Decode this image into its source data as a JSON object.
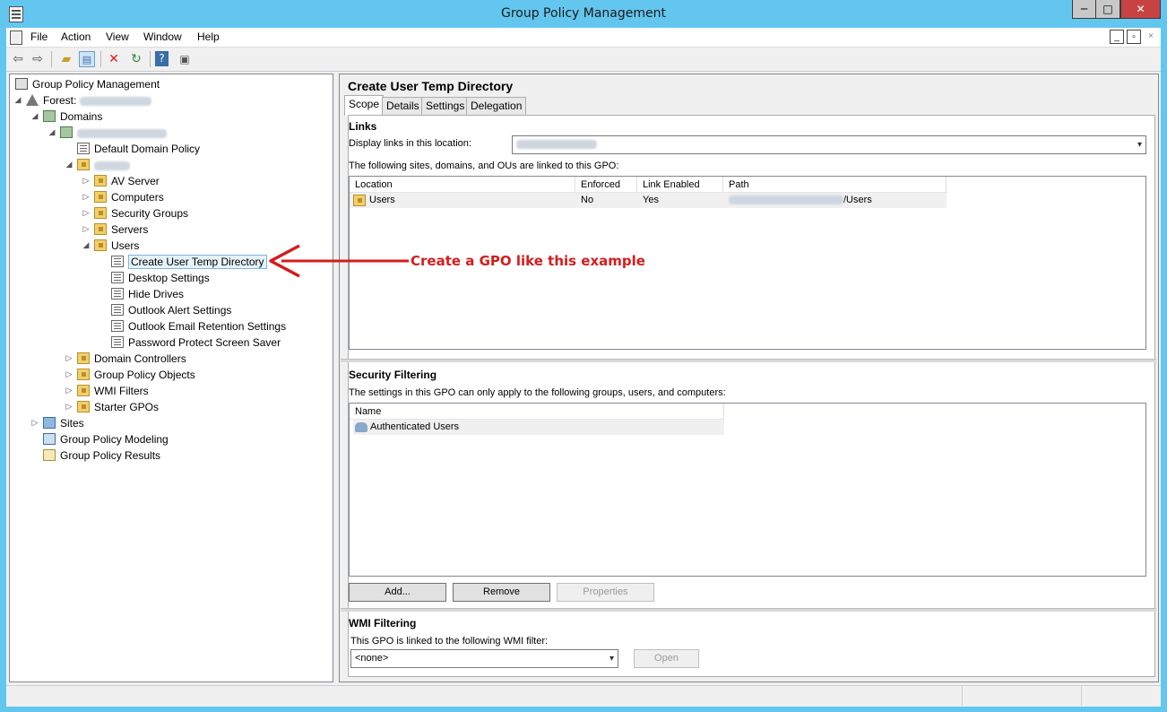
{
  "window": {
    "title": "Group Policy Management",
    "min": "─",
    "max": "□",
    "close": "✕"
  },
  "menu": [
    "File",
    "Action",
    "View",
    "Window",
    "Help"
  ],
  "mdi": {
    "min": "_",
    "restore": "▫",
    "close": "×"
  },
  "toolbar": [
    "back-icon",
    "forward-icon",
    "up-folder-icon",
    "show-hide-tree-icon",
    "delete-icon",
    "refresh-icon",
    "help-icon",
    "show-action-pane-icon"
  ],
  "tree": {
    "root": "Group Policy Management",
    "forest_label": "Forest:",
    "domains": "Domains",
    "default_domain_policy": "Default Domain Policy",
    "ous": [
      "AV Server",
      "Computers",
      "Security Groups",
      "Servers",
      "Users"
    ],
    "user_gpos": [
      "Create User Temp Directory",
      "Desktop Settings",
      "Hide Drives",
      "Outlook Alert Settings",
      "Outlook Email Retention Settings",
      "Password Protect Screen Saver"
    ],
    "domain_children": [
      "Domain Controllers",
      "Group Policy Objects",
      "WMI Filters",
      "Starter GPOs"
    ],
    "sites": "Sites",
    "modeling": "Group Policy Modeling",
    "results": "Group Policy Results"
  },
  "annotation": "Create a GPO like this example",
  "pane": {
    "title": "Create User Temp Directory",
    "tabs": [
      "Scope",
      "Details",
      "Settings",
      "Delegation"
    ],
    "links": {
      "heading": "Links",
      "display_label": "Display links in this location:",
      "desc": "The following sites, domains, and OUs are linked to this GPO:",
      "columns": [
        "Location",
        "Enforced",
        "Link Enabled",
        "Path"
      ],
      "row": {
        "location": "Users",
        "enforced": "No",
        "enabled": "Yes",
        "path_suffix": "/Users"
      }
    },
    "security": {
      "heading": "Security Filtering",
      "desc": "The settings in this GPO can only apply to the following groups, users, and computers:",
      "column": "Name",
      "row": "Authenticated Users",
      "buttons": [
        "Add...",
        "Remove",
        "Properties"
      ]
    },
    "wmi": {
      "heading": "WMI Filtering",
      "desc": "This GPO is linked to the following WMI filter:",
      "value": "<none>",
      "open": "Open"
    }
  }
}
